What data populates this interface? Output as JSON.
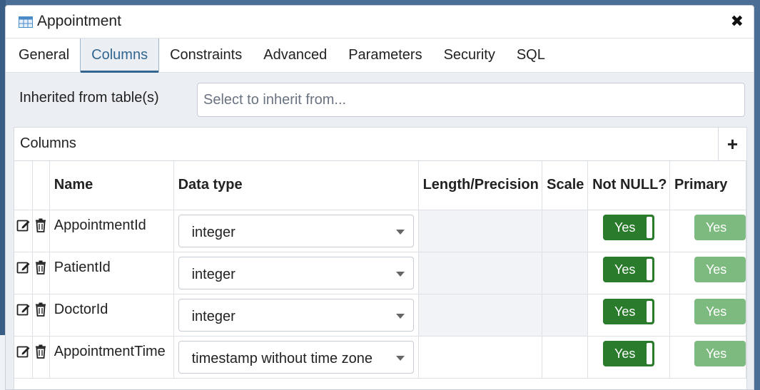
{
  "dialog": {
    "title": "Appointment"
  },
  "tabs": [
    "General",
    "Columns",
    "Constraints",
    "Advanced",
    "Parameters",
    "Security",
    "SQL"
  ],
  "active_tab": "Columns",
  "inherit": {
    "label": "Inherited from table(s)",
    "placeholder": "Select to inherit from..."
  },
  "grid": {
    "title": "Columns",
    "add_label": "+",
    "headers": {
      "name": "Name",
      "data_type": "Data type",
      "length": "Length/Precision",
      "scale": "Scale",
      "not_null": "Not NULL?",
      "primary": "Primary"
    },
    "rows": [
      {
        "name": "AppointmentId",
        "data_type": "integer",
        "not_null": "Yes",
        "primary": "Yes"
      },
      {
        "name": "PatientId",
        "data_type": "integer",
        "not_null": "Yes",
        "primary": "Yes"
      },
      {
        "name": "DoctorId",
        "data_type": "integer",
        "not_null": "Yes",
        "primary": "Yes"
      },
      {
        "name": "AppointmentTime",
        "data_type": "timestamp without time zone",
        "not_null": "Yes",
        "primary": "Yes"
      }
    ]
  },
  "colors": {
    "accent": "#326690",
    "toggle_on": "#2a7b2c",
    "toggle_faded": "#7dba7f"
  }
}
